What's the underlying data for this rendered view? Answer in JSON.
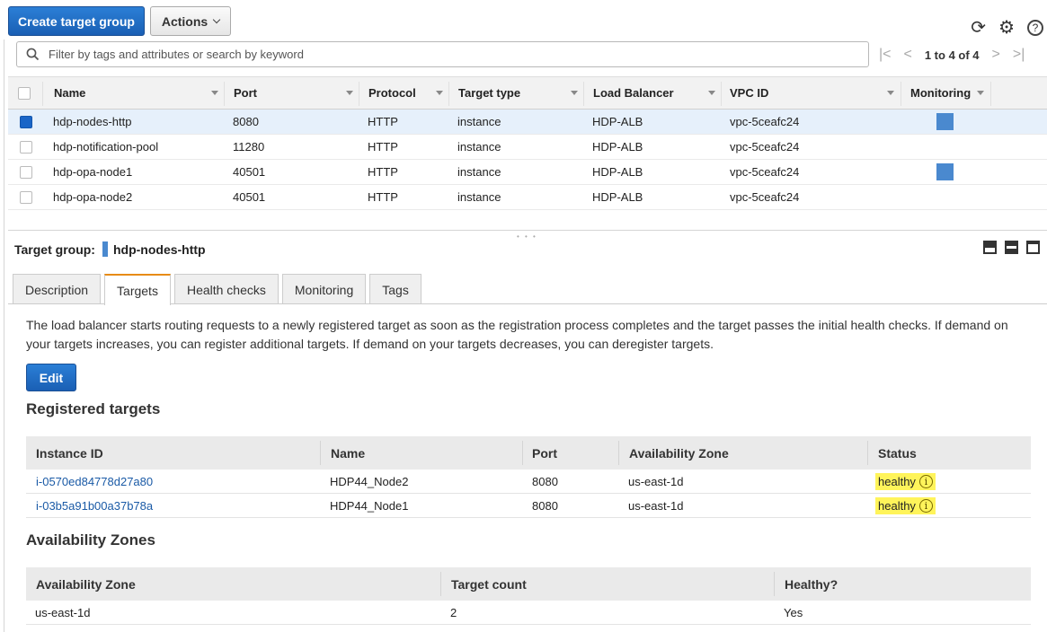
{
  "toolbar": {
    "create_label": "Create target group",
    "actions_label": "Actions",
    "icons": [
      "refresh-icon",
      "gear-icon",
      "help-icon"
    ]
  },
  "search": {
    "placeholder": "Filter by tags and attributes or search by keyword"
  },
  "pagination": {
    "text": "1 to 4 of 4"
  },
  "target_groups": {
    "columns": [
      "Name",
      "Port",
      "Protocol",
      "Target type",
      "Load Balancer",
      "VPC ID",
      "Monitoring"
    ],
    "rows": [
      {
        "name": "hdp-nodes-http",
        "port": "8080",
        "protocol": "HTTP",
        "target_type": "instance",
        "load_balancer": "HDP-ALB",
        "vpc": "vpc-5ceafc24",
        "monitoring": true,
        "selected": true
      },
      {
        "name": "hdp-notification-pool",
        "port": "11280",
        "protocol": "HTTP",
        "target_type": "instance",
        "load_balancer": "HDP-ALB",
        "vpc": "vpc-5ceafc24",
        "monitoring": false,
        "selected": false
      },
      {
        "name": "hdp-opa-node1",
        "port": "40501",
        "protocol": "HTTP",
        "target_type": "instance",
        "load_balancer": "HDP-ALB",
        "vpc": "vpc-5ceafc24",
        "monitoring": true,
        "selected": false
      },
      {
        "name": "hdp-opa-node2",
        "port": "40501",
        "protocol": "HTTP",
        "target_type": "instance",
        "load_balancer": "HDP-ALB",
        "vpc": "vpc-5ceafc24",
        "monitoring": false,
        "selected": false
      }
    ]
  },
  "details": {
    "title_label": "Target group:",
    "title_value": "hdp-nodes-http",
    "tabs": [
      "Description",
      "Targets",
      "Health checks",
      "Monitoring",
      "Tags"
    ],
    "active_tab": "Targets",
    "description": "The load balancer starts routing requests to a newly registered target as soon as the registration process completes and the target passes the initial health checks. If demand on your targets increases, you can register additional targets. If demand on your targets decreases, you can deregister targets.",
    "edit_label": "Edit"
  },
  "registered_targets": {
    "title": "Registered targets",
    "columns": [
      "Instance ID",
      "Name",
      "Port",
      "Availability Zone",
      "Status"
    ],
    "rows": [
      {
        "instance_id": "i-0570ed84778d27a80",
        "name": "HDP44_Node2",
        "port": "8080",
        "zone": "us-east-1d",
        "status": "healthy"
      },
      {
        "instance_id": "i-03b5a91b00a37b78a",
        "name": "HDP44_Node1",
        "port": "8080",
        "zone": "us-east-1d",
        "status": "healthy"
      }
    ]
  },
  "availability_zones": {
    "title": "Availability Zones",
    "columns": [
      "Availability Zone",
      "Target count",
      "Healthy?"
    ],
    "rows": [
      {
        "zone": "us-east-1d",
        "count": "2",
        "healthy": "Yes"
      }
    ]
  },
  "colors": {
    "primary_button": "#1a5fb4",
    "selected_row": "#e6f0fb",
    "monitoring_square": "#4a89cf",
    "active_tab_accent": "#e78b16",
    "healthy_highlight": "#fff45a",
    "link": "#1a5aa6"
  }
}
